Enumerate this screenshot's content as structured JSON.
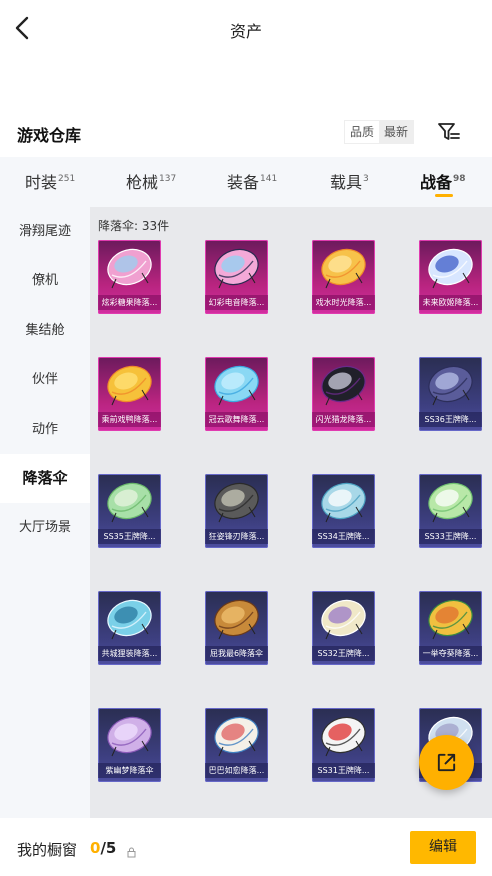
{
  "header": {
    "title": "资产"
  },
  "section": {
    "title": "游戏仓库",
    "sort_options": [
      "品质",
      "最新"
    ],
    "sort_active_index": 1
  },
  "tabs": [
    {
      "label": "时装",
      "count": "251"
    },
    {
      "label": "枪械",
      "count": "137"
    },
    {
      "label": "装备",
      "count": "141"
    },
    {
      "label": "载具",
      "count": "3"
    },
    {
      "label": "战备",
      "count": "98"
    }
  ],
  "active_tab_index": 4,
  "sidebar": {
    "items": [
      "滑翔尾迹",
      "僚机",
      "集结舱",
      "伙伴",
      "动作",
      "降落伞",
      "大厅场景"
    ],
    "active_index": 5
  },
  "content": {
    "count_label": "降落伞: 33件",
    "items": [
      {
        "label": "炫彩糖果降落...",
        "rarity": "pink",
        "colors": [
          "#f0a0d0",
          "#9ad0f0",
          "#ffffff"
        ]
      },
      {
        "label": "幻彩电音降落...",
        "rarity": "pink",
        "colors": [
          "#f4a9d8",
          "#8fd4f4",
          "#2a2a50"
        ]
      },
      {
        "label": "戏水时光降落...",
        "rarity": "pink",
        "colors": [
          "#f7c24a",
          "#ffe7a0",
          "#f08a2a"
        ]
      },
      {
        "label": "未来欧姬降落...",
        "rarity": "pink",
        "colors": [
          "#d8e6ff",
          "#3e5cc8",
          "#ffffff"
        ]
      },
      {
        "label": "乘前戏鸭降落...",
        "rarity": "pink",
        "colors": [
          "#f6c13a",
          "#ffe17a",
          "#f08a2a"
        ]
      },
      {
        "label": "冠云歌舞降落...",
        "rarity": "pink",
        "colors": [
          "#8ad8f4",
          "#c8f0ff",
          "#3ca8e0"
        ]
      },
      {
        "label": "闪光猎龙降落...",
        "rarity": "pink",
        "colors": [
          "#20202a",
          "#cfcfe0",
          "#6a2a8a"
        ]
      },
      {
        "label": "SS36王牌降...",
        "rarity": "blue",
        "colors": [
          "#5a5c9a",
          "#b8c0e8",
          "#2c2e5a"
        ]
      },
      {
        "label": "SS35王牌降...",
        "rarity": "blue",
        "colors": [
          "#a8e0a8",
          "#e8f4e0",
          "#6ab86a"
        ]
      },
      {
        "label": "狂姿锋刃降落...",
        "rarity": "blue",
        "colors": [
          "#5a5a5a",
          "#c8c8b8",
          "#2a2a2a"
        ]
      },
      {
        "label": "SS34王牌降...",
        "rarity": "blue",
        "colors": [
          "#a8d8e8",
          "#ffffff",
          "#4aa0c0"
        ]
      },
      {
        "label": "SS33王牌降...",
        "rarity": "blue",
        "colors": [
          "#b8e8a8",
          "#ffffff",
          "#70c070"
        ]
      },
      {
        "label": "共城狸装降落...",
        "rarity": "blue",
        "colors": [
          "#7ad0e8",
          "#2a7aa0",
          "#e8f8ff"
        ]
      },
      {
        "label": "屈我最6降落伞",
        "rarity": "blue",
        "colors": [
          "#c88a3a",
          "#f0c070",
          "#6a3a1a"
        ]
      },
      {
        "label": "SS32王牌降...",
        "rarity": "blue",
        "colors": [
          "#f0e8c8",
          "#9a7ac8",
          "#ffffff"
        ]
      },
      {
        "label": "一举夺葵降落...",
        "rarity": "blue",
        "colors": [
          "#f0c040",
          "#e07030",
          "#3a8a40"
        ]
      },
      {
        "label": "紫幽梦降落伞",
        "rarity": "blue",
        "colors": [
          "#d0b0e8",
          "#f0e0ff",
          "#8a5ab8"
        ]
      },
      {
        "label": "巴巴如愈降落...",
        "rarity": "blue",
        "colors": [
          "#f4f0e8",
          "#e06060",
          "#4080c0"
        ]
      },
      {
        "label": "SS31王牌降...",
        "rarity": "blue",
        "colors": [
          "#f4f4f4",
          "#e03030",
          "#303030"
        ]
      },
      {
        "label": "",
        "rarity": "blue",
        "colors": [
          "#d0e0f0",
          "#a0a0c8",
          "#ffffff"
        ]
      }
    ]
  },
  "bottom_bar": {
    "label": "我的橱窗",
    "current": "0",
    "total": "/5",
    "edit_label": "编辑"
  },
  "colors": {
    "accent": "#ffb000"
  }
}
